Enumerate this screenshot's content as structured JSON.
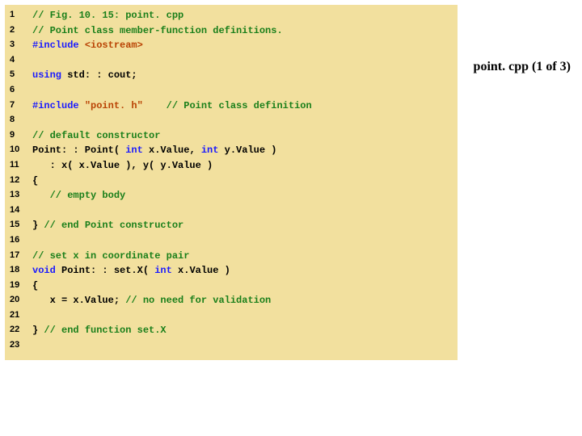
{
  "slide_label": "point. cpp (1 of 3)",
  "lines": [
    {
      "n": "1",
      "segs": [
        {
          "cls": "cmt",
          "t": "// Fig. 10. 15: point. cpp"
        }
      ]
    },
    {
      "n": "2",
      "segs": [
        {
          "cls": "cmt",
          "t": "// Point class member-function definitions."
        }
      ]
    },
    {
      "n": "3",
      "segs": [
        {
          "cls": "pre",
          "t": "#include "
        },
        {
          "cls": "inc",
          "t": "<iostream>"
        }
      ]
    },
    {
      "n": "4",
      "segs": []
    },
    {
      "n": "5",
      "segs": [
        {
          "cls": "kw",
          "t": "using "
        },
        {
          "cls": "",
          "t": "std: : cout;"
        }
      ]
    },
    {
      "n": "6",
      "segs": []
    },
    {
      "n": "7",
      "segs": [
        {
          "cls": "pre",
          "t": "#include "
        },
        {
          "cls": "inc",
          "t": "\"point. h\""
        },
        {
          "cls": "",
          "t": "    "
        },
        {
          "cls": "cmt",
          "t": "// Point class definition"
        }
      ]
    },
    {
      "n": "8",
      "segs": []
    },
    {
      "n": "9",
      "segs": [
        {
          "cls": "cmt",
          "t": "// default constructor"
        }
      ]
    },
    {
      "n": "10",
      "segs": [
        {
          "cls": "",
          "t": "Point: : Point( "
        },
        {
          "cls": "kw",
          "t": "int"
        },
        {
          "cls": "",
          "t": " x.Value"
        },
        {
          "cls": "",
          "t": ", "
        },
        {
          "cls": "kw",
          "t": "int"
        },
        {
          "cls": "",
          "t": " y.Value )"
        }
      ]
    },
    {
      "n": "11",
      "segs": [
        {
          "cls": "",
          "t": "   : x( x.Value ), y( y.Value )"
        }
      ]
    },
    {
      "n": "12",
      "segs": [
        {
          "cls": "",
          "t": "{"
        }
      ]
    },
    {
      "n": "13",
      "segs": [
        {
          "cls": "",
          "t": "   "
        },
        {
          "cls": "cmt",
          "t": "// empty body"
        }
      ]
    },
    {
      "n": "14",
      "segs": []
    },
    {
      "n": "15",
      "segs": [
        {
          "cls": "",
          "t": "} "
        },
        {
          "cls": "cmt",
          "t": "// end Point constructor"
        }
      ]
    },
    {
      "n": "16",
      "segs": []
    },
    {
      "n": "17",
      "segs": [
        {
          "cls": "cmt",
          "t": "// set x in coordinate pair"
        }
      ]
    },
    {
      "n": "18",
      "segs": [
        {
          "cls": "kw",
          "t": "void"
        },
        {
          "cls": "",
          "t": " Point: : set.X( "
        },
        {
          "cls": "kw",
          "t": "int"
        },
        {
          "cls": "",
          "t": " x.Value )"
        }
      ]
    },
    {
      "n": "19",
      "segs": [
        {
          "cls": "",
          "t": "{"
        }
      ]
    },
    {
      "n": "20",
      "segs": [
        {
          "cls": "",
          "t": "   x = x.Value; "
        },
        {
          "cls": "cmt",
          "t": "// no need for validation"
        }
      ]
    },
    {
      "n": "21",
      "segs": []
    },
    {
      "n": "22",
      "segs": [
        {
          "cls": "",
          "t": "} "
        },
        {
          "cls": "cmt",
          "t": "// end function set.X"
        }
      ]
    },
    {
      "n": "23",
      "segs": []
    }
  ]
}
